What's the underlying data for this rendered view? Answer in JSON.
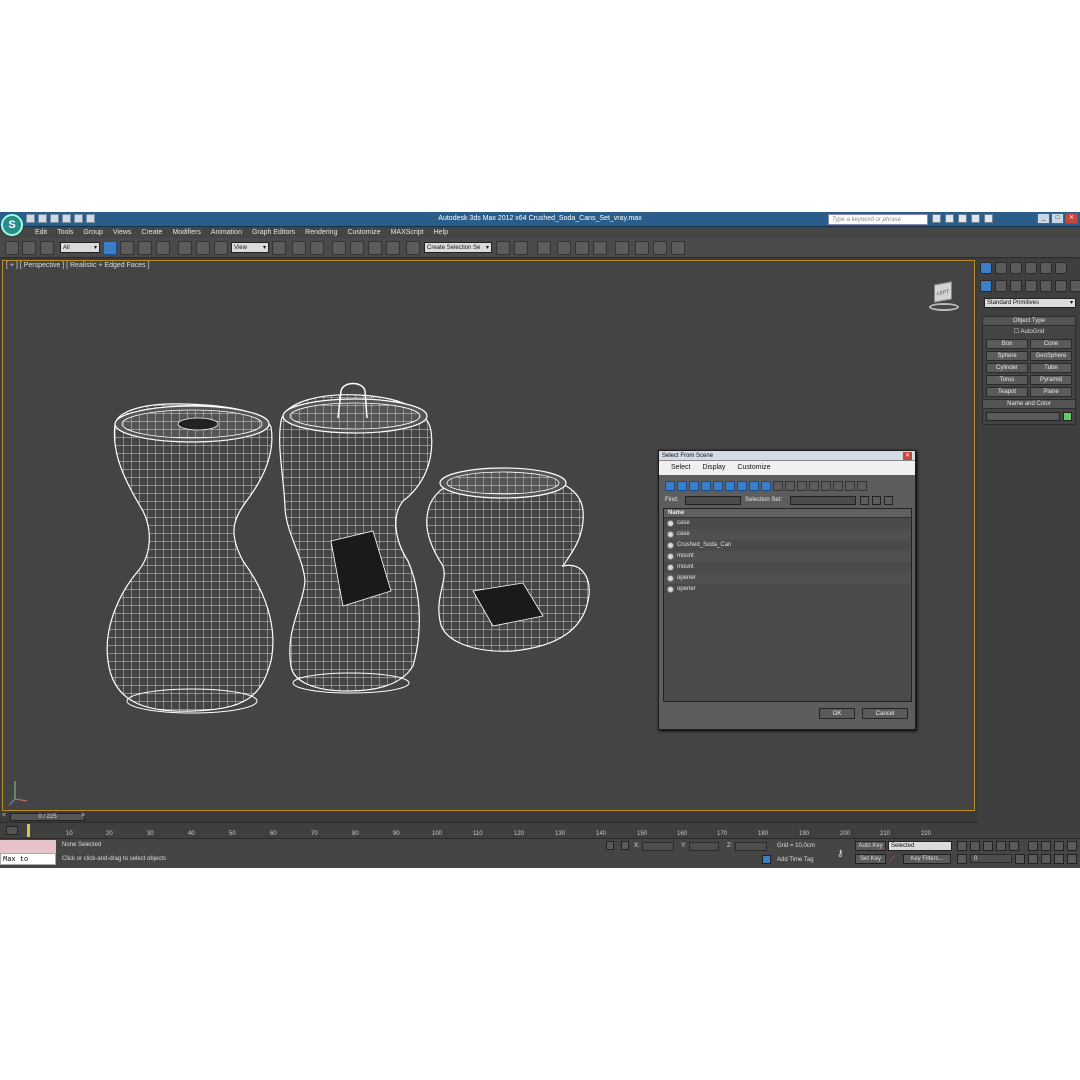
{
  "window": {
    "title": "Autodesk 3ds Max  2012 x64      Crushed_Soda_Cans_Set_vray.max",
    "search_placeholder": "Type a keyword or phrase"
  },
  "menu": [
    "Edit",
    "Tools",
    "Group",
    "Views",
    "Create",
    "Modifiers",
    "Animation",
    "Graph Editors",
    "Rendering",
    "Customize",
    "MAXScript",
    "Help"
  ],
  "toolbar": {
    "filter_value": "All",
    "refcoord_value": "View",
    "selection_set_value": "Create Selection Se"
  },
  "viewport": {
    "label": "[ + ] [ Perspective ] [ Realistic + Edged Faces ]",
    "viewcube_label": "LEFT"
  },
  "command_panel": {
    "category_value": "Standard Primitives",
    "object_type_title": "Object Type",
    "autogrid_label": "AutoGrid",
    "object_buttons": [
      "Box",
      "Cone",
      "Sphere",
      "GeoSphere",
      "Cylinder",
      "Tube",
      "Torus",
      "Pyramid",
      "Teapot",
      "Plane"
    ],
    "name_color_title": "Name and Color",
    "color_hex": "#5fce6a"
  },
  "dialog": {
    "title": "Select From Scene",
    "menus": [
      "Select",
      "Display",
      "Customize"
    ],
    "find_label": "Find:",
    "selection_set_label": "Selection Set:",
    "column_name": "Name",
    "items": [
      "case",
      "case",
      "Crushed_Soda_Can",
      "mount",
      "mount",
      "opener",
      "opener"
    ],
    "ok_label": "OK",
    "cancel_label": "Cancel"
  },
  "timeline": {
    "position": "0 / 225",
    "ticks": [
      "10",
      "20",
      "30",
      "40",
      "50",
      "60",
      "70",
      "80",
      "90",
      "100",
      "110",
      "120",
      "130",
      "140",
      "150",
      "160",
      "170",
      "180",
      "190",
      "200",
      "210",
      "220"
    ]
  },
  "status": {
    "maxscript_text": "Max to Physc.",
    "selection_text": "None Selected",
    "prompt_text": "Click or click-and-drag to select objects",
    "x_label": "X:",
    "y_label": "Y:",
    "z_label": "Z:",
    "grid_text": "Grid = 10,0cm",
    "add_time_tag": "Add Time Tag",
    "auto_key": "Auto Key",
    "set_key": "Set Key",
    "key_mode_value": "Selected",
    "key_filters": "Key Filters...",
    "frame_value": "0"
  },
  "colors": {
    "accent": "#3c7fc6",
    "viewport_bg": "#444444",
    "viewport_border": "#b68f2a",
    "titlebar": "#2a5d8a"
  }
}
